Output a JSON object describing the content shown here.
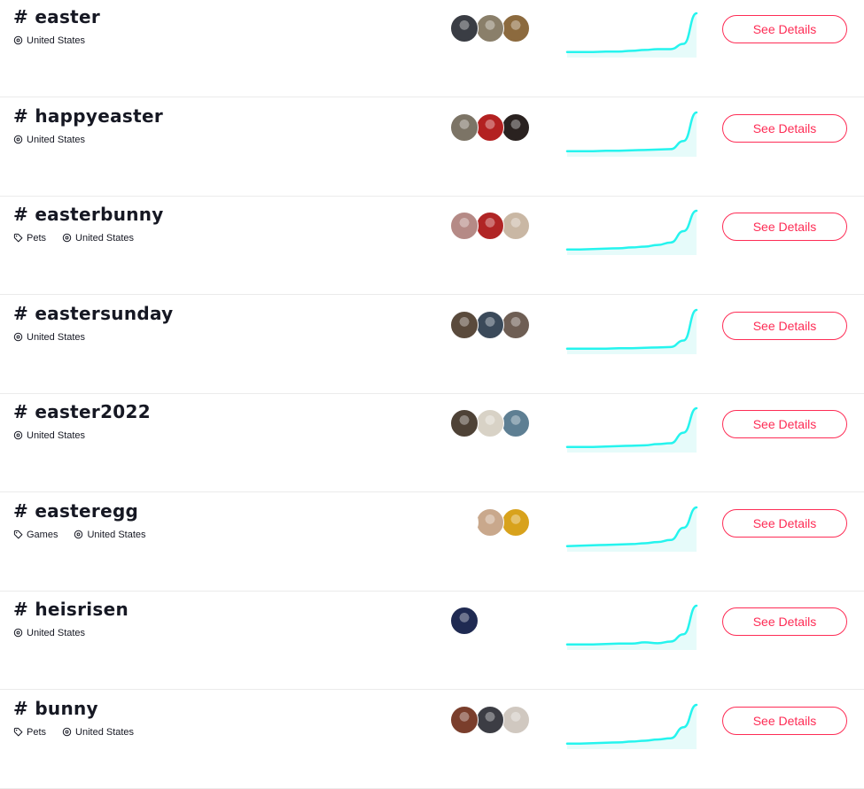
{
  "hashtags": [
    {
      "tag": "# easter",
      "meta": [
        {
          "icon": "location-icon",
          "text": "United States"
        }
      ],
      "avatars": [
        "#3a3d44",
        "#8a7f6a",
        "#8c6a3e"
      ],
      "trend": [
        0.05,
        0.05,
        0.05,
        0.06,
        0.06,
        0.08,
        0.1,
        0.12,
        0.12,
        0.25,
        1.0
      ],
      "button": "See Details"
    },
    {
      "tag": "# happyeaster",
      "meta": [
        {
          "icon": "location-icon",
          "text": "United States"
        }
      ],
      "avatars": [
        "#7c7466",
        "#b32121",
        "#2a2220"
      ],
      "trend": [
        0.05,
        0.05,
        0.05,
        0.06,
        0.06,
        0.07,
        0.08,
        0.09,
        0.1,
        0.3,
        1.0
      ],
      "button": "See Details"
    },
    {
      "tag": "# easterbunny",
      "meta": [
        {
          "icon": "tag-icon",
          "text": "Pets"
        },
        {
          "icon": "location-icon",
          "text": "United States"
        }
      ],
      "avatars": [
        "#b58a86",
        "#b02525",
        "#c9b7a4"
      ],
      "trend": [
        0.05,
        0.05,
        0.06,
        0.07,
        0.08,
        0.1,
        0.12,
        0.16,
        0.22,
        0.5,
        1.0
      ],
      "button": "See Details"
    },
    {
      "tag": "# eastersunday",
      "meta": [
        {
          "icon": "location-icon",
          "text": "United States"
        }
      ],
      "avatars": [
        "#5a4a3c",
        "#3b4a5a",
        "#6e5e54"
      ],
      "trend": [
        0.05,
        0.05,
        0.05,
        0.05,
        0.06,
        0.06,
        0.07,
        0.08,
        0.09,
        0.25,
        1.0
      ],
      "button": "See Details"
    },
    {
      "tag": "# easter2022",
      "meta": [
        {
          "icon": "location-icon",
          "text": "United States"
        }
      ],
      "avatars": [
        "#4e4236",
        "#d8d2c6",
        "#5e7f93"
      ],
      "trend": [
        0.05,
        0.05,
        0.05,
        0.06,
        0.07,
        0.08,
        0.09,
        0.12,
        0.14,
        0.4,
        1.0
      ],
      "button": "See Details"
    },
    {
      "tag": "# easteregg",
      "meta": [
        {
          "icon": "tag-icon",
          "text": "Games"
        },
        {
          "icon": "location-icon",
          "text": "United States"
        }
      ],
      "avatars": [
        "#ffffff",
        "#c9a88c",
        "#d8a21c"
      ],
      "trend": [
        0.05,
        0.06,
        0.07,
        0.08,
        0.09,
        0.1,
        0.12,
        0.15,
        0.2,
        0.5,
        1.0
      ],
      "button": "See Details"
    },
    {
      "tag": "# heisrisen",
      "meta": [
        {
          "icon": "location-icon",
          "text": "United States"
        }
      ],
      "avatars": [
        "#1f2a52"
      ],
      "trend": [
        0.05,
        0.05,
        0.05,
        0.06,
        0.07,
        0.07,
        0.1,
        0.08,
        0.12,
        0.3,
        1.0
      ],
      "button": "See Details"
    },
    {
      "tag": "# bunny",
      "meta": [
        {
          "icon": "tag-icon",
          "text": "Pets"
        },
        {
          "icon": "location-icon",
          "text": "United States"
        }
      ],
      "avatars": [
        "#7a3e2c",
        "#3c3d44",
        "#d0c8c0"
      ],
      "trend": [
        0.05,
        0.05,
        0.06,
        0.07,
        0.08,
        0.1,
        0.12,
        0.15,
        0.18,
        0.45,
        1.0
      ],
      "button": "See Details"
    }
  ],
  "colors": {
    "accent": "#fe2c55",
    "trend_line": "#25f4ee",
    "trend_fill": "#e6fbfa",
    "divider": "#ebebeb",
    "text": "#161823"
  }
}
